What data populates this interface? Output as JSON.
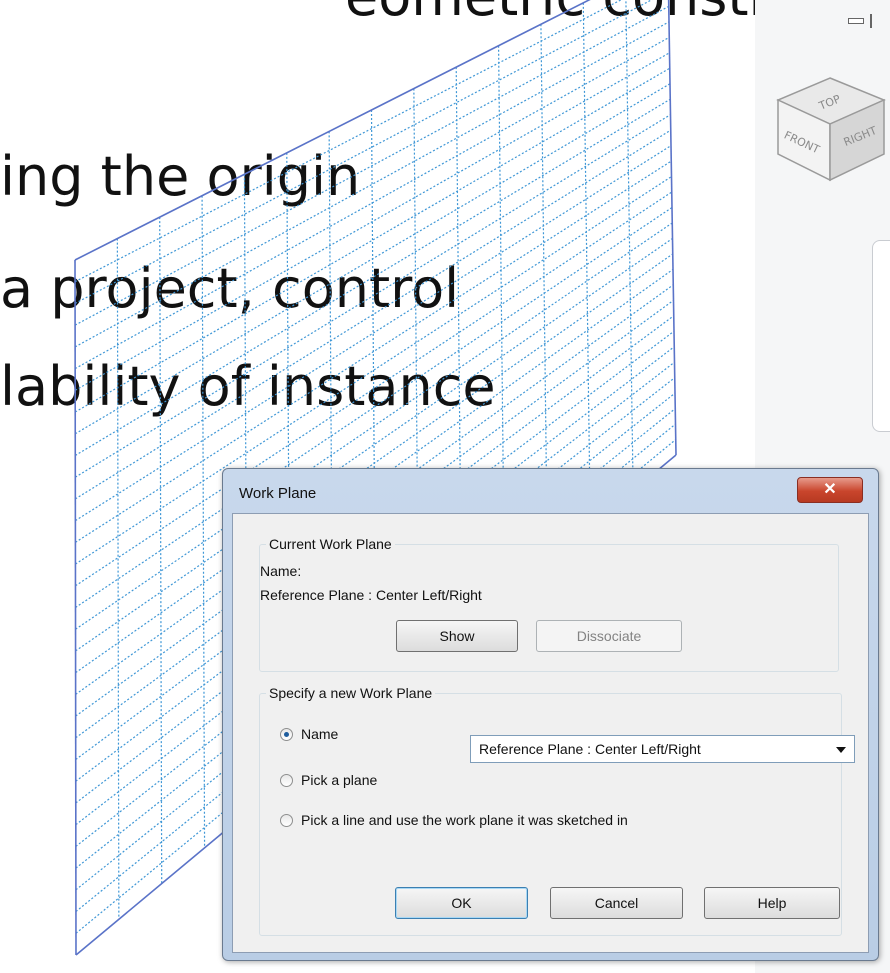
{
  "slide": {
    "heading": "eometric constraints",
    "line1": "ing the origin",
    "line2": "a project, control",
    "line3": "lability of instance"
  },
  "viewcube": {
    "top_label": "TOP",
    "front_label": "FRONT",
    "right_label": "RIGHT"
  },
  "dialog": {
    "title": "Work Plane",
    "current": {
      "legend": "Current Work Plane",
      "name_label": "Name:",
      "name_value": "Reference Plane : Center Left/Right",
      "show_label": "Show",
      "dissociate_label": "Dissociate"
    },
    "specify": {
      "legend": "Specify a new Work Plane",
      "options": [
        {
          "label": "Name",
          "checked": true
        },
        {
          "label": "Pick a plane",
          "checked": false
        },
        {
          "label": "Pick a line and use the work plane it was sketched in",
          "checked": false
        }
      ],
      "name_select_value": "Reference Plane : Center Left/Right"
    },
    "buttons": {
      "ok": "OK",
      "cancel": "Cancel",
      "help": "Help"
    }
  },
  "colors": {
    "grid_line": "#3f97d6",
    "grid_border": "#5a73c8",
    "dialog_frame": "#b9cde5",
    "close_button": "#c9452c"
  }
}
